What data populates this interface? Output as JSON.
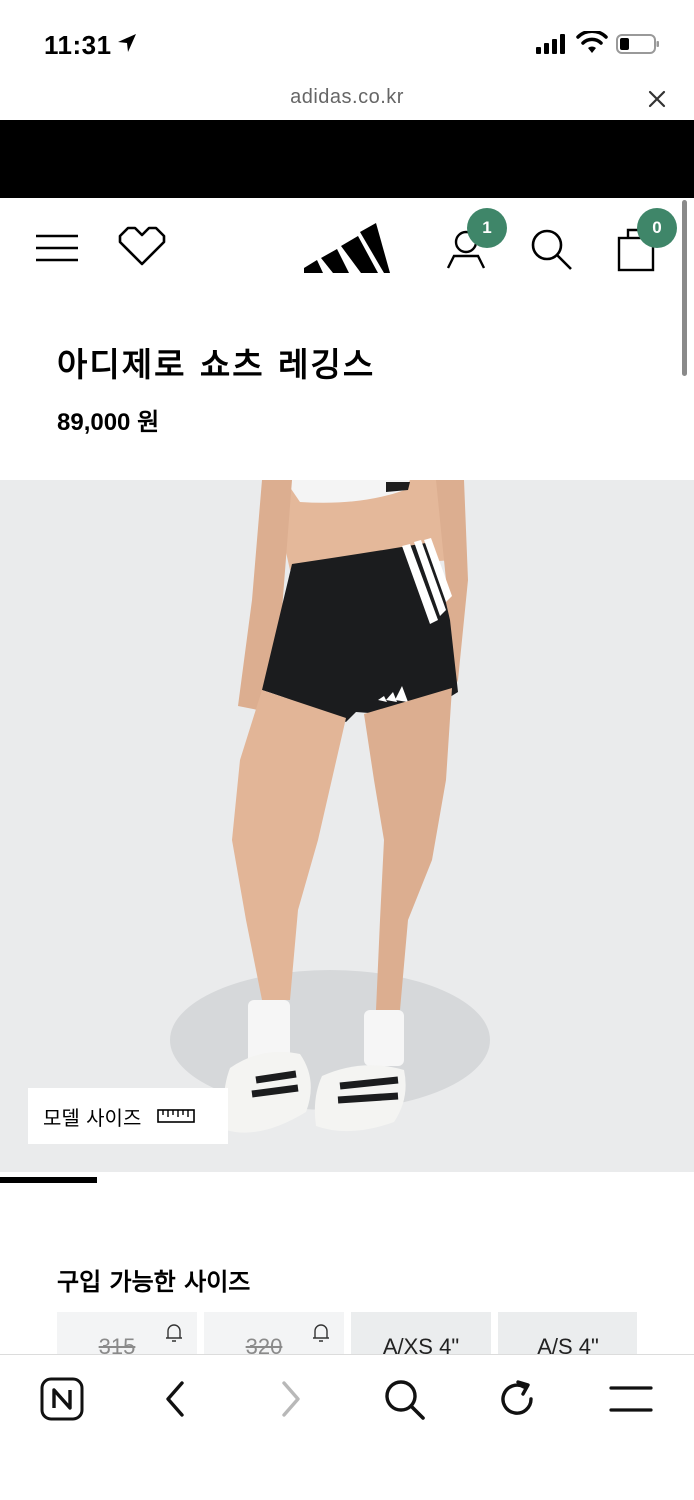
{
  "status_bar": {
    "time": "11:31"
  },
  "browser": {
    "url": "adidas.co.kr"
  },
  "header": {
    "account_badge_count": "1",
    "cart_badge_count": "0",
    "icons": [
      "menu-icon",
      "heart-icon",
      "adidas-logo",
      "user-icon",
      "search-icon",
      "shopping-bag-icon"
    ]
  },
  "product": {
    "title": "아디제로 쇼츠 레깅스",
    "price": "89,000 원",
    "model_size_label": "모델 사이즈"
  },
  "carousel": {
    "progress": 0.14
  },
  "sizes": {
    "title": "구입 가능한 사이즈",
    "items": [
      {
        "label": "315",
        "available": false
      },
      {
        "label": "320",
        "available": false
      },
      {
        "label": "A/XS 4\"",
        "available": true
      },
      {
        "label": "A/S 4\"",
        "available": true
      }
    ]
  },
  "bottom_toolbar": {
    "icons": [
      "naver-icon",
      "back-icon",
      "forward-icon",
      "search-icon",
      "reload-icon",
      "menu-icon"
    ]
  },
  "colors": {
    "badge": "#3f8669",
    "image_background": "#eaebec",
    "banner": "#000000"
  }
}
